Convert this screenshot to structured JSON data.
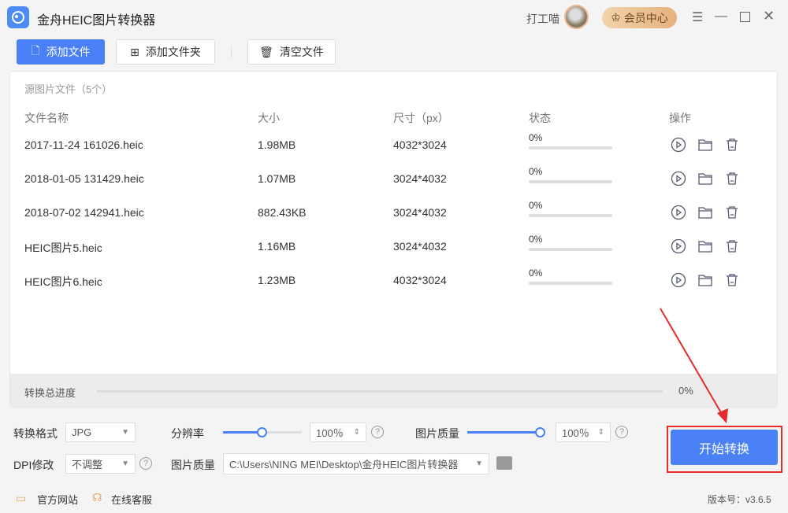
{
  "app": {
    "title": "金舟HEIC图片转换器",
    "user": "打工喵",
    "vip_label": "会员中心"
  },
  "toolbar": {
    "add_file": "添加文件",
    "add_folder": "添加文件夹",
    "clear": "清空文件"
  },
  "list": {
    "source_label": "源图片文件（5个）",
    "columns": [
      "文件名称",
      "大小",
      "尺寸（px）",
      "状态",
      "操作"
    ],
    "rows": [
      {
        "name": "2017-11-24 161026.heic",
        "size": "1.98MB",
        "dim": "4032*3024",
        "status": "0%",
        "progress": 0
      },
      {
        "name": "2018-01-05 131429.heic",
        "size": "1.07MB",
        "dim": "3024*4032",
        "status": "0%",
        "progress": 0
      },
      {
        "name": "2018-07-02 142941.heic",
        "size": "882.43KB",
        "dim": "3024*4032",
        "status": "0%",
        "progress": 0
      },
      {
        "name": "HEIC图片5.heic",
        "size": "1.16MB",
        "dim": "3024*4032",
        "status": "0%",
        "progress": 0
      },
      {
        "name": "HEIC图片6.heic",
        "size": "1.23MB",
        "dim": "4032*3024",
        "status": "0%",
        "progress": 0
      }
    ],
    "total_label": "转换总进度",
    "total_value": "0%"
  },
  "settings": {
    "format_label": "转换格式",
    "format_value": "JPG",
    "resolution_label": "分辨率",
    "resolution_value": "100％",
    "resolution_pct": 50,
    "quality_label": "图片质量",
    "quality_value": "100％",
    "quality_pct": 100,
    "dpi_label": "DPI修改",
    "dpi_value": "不调整",
    "output_label": "图片质量",
    "output_path": "C:\\Users\\NING MEI\\Desktop\\金舟HEIC图片转换器"
  },
  "start_label": "开始转换",
  "footer": {
    "website": "官方网站",
    "support": "在线客服",
    "version": "版本号：v3.6.5"
  },
  "colors": {
    "accent": "#4a80f5",
    "annotation": "#e62b2b"
  }
}
